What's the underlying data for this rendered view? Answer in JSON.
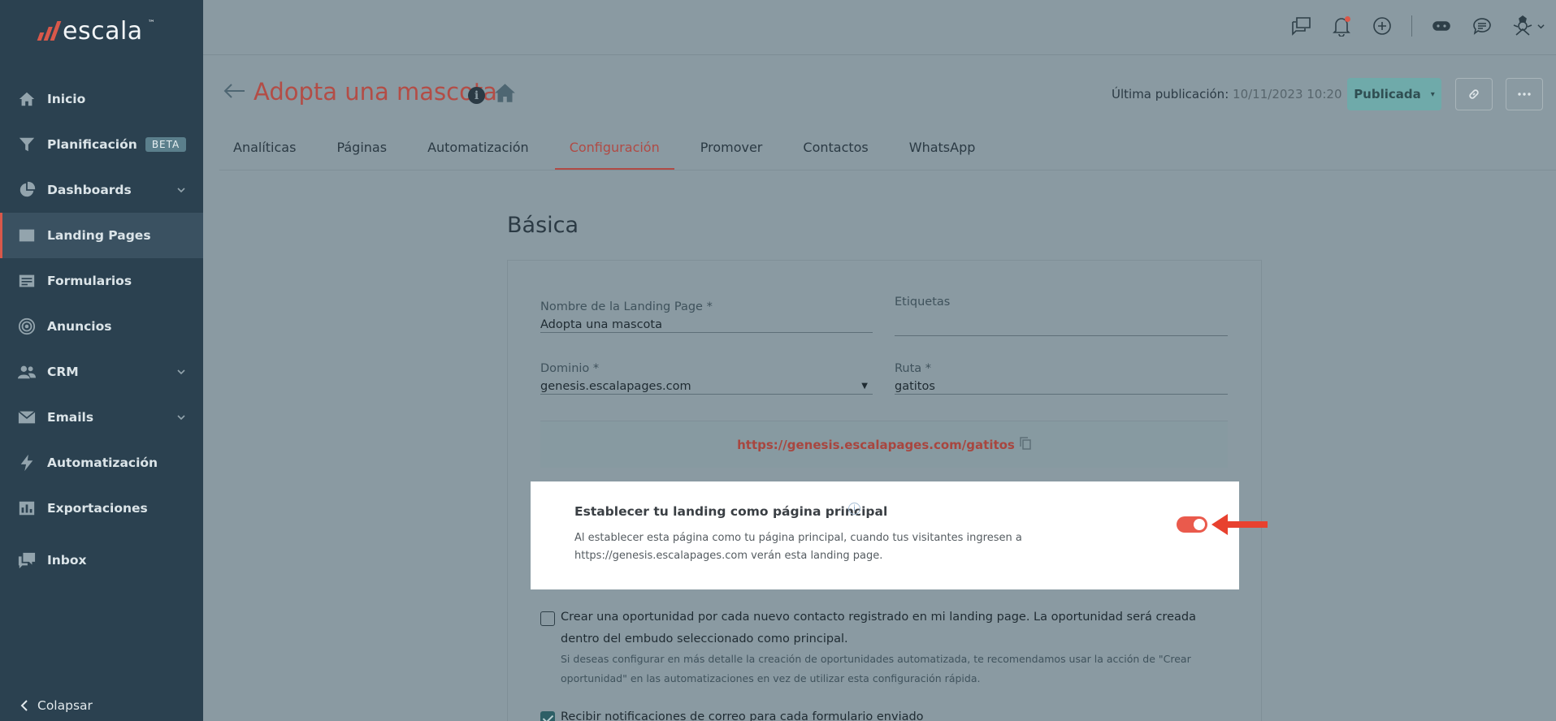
{
  "brand": {
    "name": "escala",
    "tm": "™",
    "accent": "#d9584a"
  },
  "sidebar": {
    "items": [
      {
        "label": "Inicio",
        "icon": "home-icon"
      },
      {
        "label": "Planificación",
        "icon": "funnel-icon",
        "badge": "BETA"
      },
      {
        "label": "Dashboards",
        "icon": "pie-chart-icon",
        "expandable": true
      },
      {
        "label": "Landing Pages",
        "icon": "landing-page-icon",
        "active": true
      },
      {
        "label": "Formularios",
        "icon": "form-icon"
      },
      {
        "label": "Anuncios",
        "icon": "target-icon"
      },
      {
        "label": "CRM",
        "icon": "users-icon",
        "expandable": true
      },
      {
        "label": "Emails",
        "icon": "email-icon",
        "expandable": true
      },
      {
        "label": "Automatización",
        "icon": "lightning-icon"
      },
      {
        "label": "Exportaciones",
        "icon": "bar-chart-icon"
      },
      {
        "label": "Inbox",
        "icon": "chat-icon"
      }
    ],
    "collapse_label": "Colapsar"
  },
  "header": {
    "title": "Adopta una mascota",
    "publish_label": "Última publicación:",
    "publish_date": "10/11/2023 10:20",
    "status_button": "Publicada"
  },
  "tabs": [
    {
      "label": "Analíticas"
    },
    {
      "label": "Páginas"
    },
    {
      "label": "Automatización"
    },
    {
      "label": "Configuración",
      "active": true
    },
    {
      "label": "Promover"
    },
    {
      "label": "Contactos"
    },
    {
      "label": "WhatsApp"
    }
  ],
  "section": {
    "title": "Básica",
    "fields": {
      "name_label": "Nombre de la Landing Page *",
      "name_value": "Adopta una mascota",
      "tags_label": "Etiquetas",
      "tags_value": "",
      "domain_label": "Dominio *",
      "domain_value": "genesis.escalapages.com",
      "route_label": "Ruta *",
      "route_value": "gatitos"
    },
    "url": "https://genesis.escalapages.com/gatitos",
    "main_page": {
      "title": "Establecer tu landing como página principal",
      "description": "Al establecer esta página como tu página principal, cuando tus visitantes ingresen a https://genesis.escalapages.com verán esta landing page.",
      "enabled": true
    },
    "opportunity": {
      "label": "Crear una oportunidad por cada nuevo contacto registrado en mi landing page. La oportunidad será creada dentro del embudo seleccionado como principal.",
      "hint": "Si deseas configurar en más detalle la creación de oportunidades automatizada, te recomendamos usar la acción de \"Crear oportunidad\" en las automatizaciones en vez de utilizar esta configuración rápida.",
      "checked": false
    },
    "notifications": {
      "label": "Recibir notificaciones de correo para cada formulario enviado",
      "checked": true
    }
  }
}
